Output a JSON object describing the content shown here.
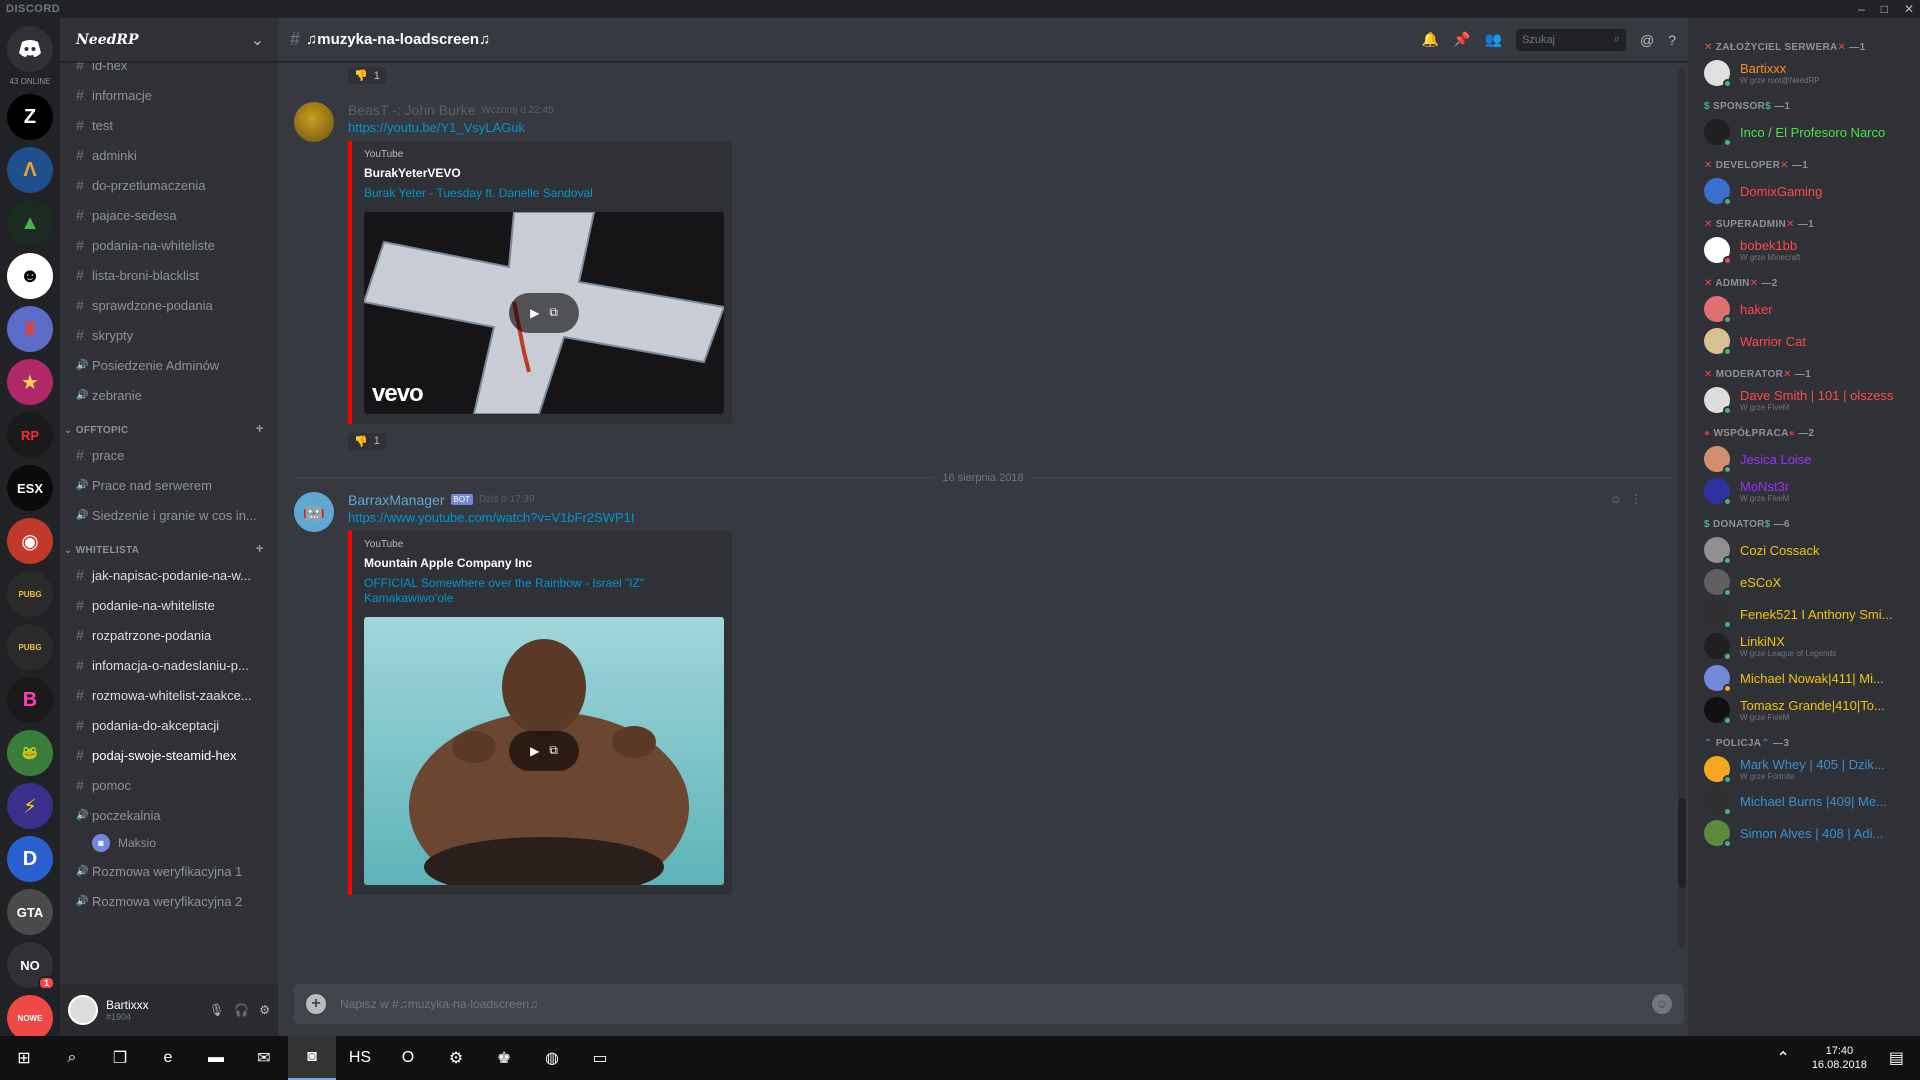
{
  "window": {
    "brand": "DISCORD",
    "controls": [
      "–",
      "□",
      "✕"
    ]
  },
  "servers": {
    "online": "43 ONLINE",
    "items": [
      {
        "label": "Z",
        "color": "#ffffff",
        "bg": "#000000"
      },
      {
        "label": "Λ",
        "color": "#f0a030",
        "bg": "#1f4f8c"
      },
      {
        "label": "▲",
        "color": "#4caf50",
        "bg": "#1b2b22"
      },
      {
        "label": "☻",
        "color": "#000000",
        "bg": "#ffffff"
      },
      {
        "label": "♜",
        "color": "#e04040",
        "bg": "#5a6bc8"
      },
      {
        "label": "★",
        "color": "#ffd24a",
        "bg": "#b0286a"
      },
      {
        "label": "RP",
        "color": "#ff2a2a",
        "bg": "#1a1a1a"
      },
      {
        "label": "ESX",
        "color": "#ffffff",
        "bg": "#0a0a0a"
      },
      {
        "label": "◉",
        "color": "#ffffff",
        "bg": "#c0392b"
      },
      {
        "label": "PUBG",
        "color": "#f0c040",
        "bg": "#2a2a2a"
      },
      {
        "label": "PUBG",
        "color": "#f0c040",
        "bg": "#2a2a2a"
      },
      {
        "label": "B",
        "color": "#ff3fae",
        "bg": "#1a1a1a"
      },
      {
        "label": "🐸",
        "color": "#ffffff",
        "bg": "#3a7d3a"
      },
      {
        "label": "⚡",
        "color": "#ffcc00",
        "bg": "#3a2f8c"
      },
      {
        "label": "D",
        "color": "#ffffff",
        "bg": "#2a5fd0"
      },
      {
        "label": "GTA",
        "color": "#ffffff",
        "bg": "#4a4a4a"
      },
      {
        "label": "NO",
        "color": "#ffffff",
        "bg": "#2f3136",
        "badge": "1"
      },
      {
        "label": "NOWE",
        "color": "#ffffff",
        "bg": "#f04747"
      }
    ]
  },
  "guild": {
    "name": "NeedRP"
  },
  "channels": [
    {
      "type": "text",
      "name": "id-hex"
    },
    {
      "type": "text",
      "name": "informacje"
    },
    {
      "type": "text",
      "name": "test"
    },
    {
      "type": "text",
      "name": "adminki"
    },
    {
      "type": "text",
      "name": "do-przetlumaczenia"
    },
    {
      "type": "text",
      "name": "pajace-sedesa"
    },
    {
      "type": "text",
      "name": "podania-na-whiteliste"
    },
    {
      "type": "text",
      "name": "lista-broni-blacklist"
    },
    {
      "type": "text",
      "name": "sprawdzone-podania"
    },
    {
      "type": "text",
      "name": "skrypty"
    },
    {
      "type": "voice",
      "name": "Posiedzenie Adminów"
    },
    {
      "type": "voice",
      "name": "zebranie"
    },
    {
      "type": "category",
      "name": "OFFTOPIC"
    },
    {
      "type": "text",
      "name": "prace"
    },
    {
      "type": "voice",
      "name": "Prace nad serwerem"
    },
    {
      "type": "voice",
      "name": "Siedzenie i granie w cos in..."
    },
    {
      "type": "category",
      "name": "WHITELISTA"
    },
    {
      "type": "text",
      "name": "jak-napisac-podanie-na-w...",
      "unread": true
    },
    {
      "type": "text",
      "name": "podanie-na-whiteliste",
      "unread": true
    },
    {
      "type": "text",
      "name": "rozpatrzone-podania",
      "unread": true
    },
    {
      "type": "text",
      "name": "infomacja-o-nadeslaniu-p...",
      "unread": true
    },
    {
      "type": "text",
      "name": "rozmowa-whitelist-zaakce...",
      "unread": true
    },
    {
      "type": "text",
      "name": "podania-do-akceptacji",
      "unread": true
    },
    {
      "type": "text",
      "name": "podaj-swoje-steamid-hex",
      "active": true
    },
    {
      "type": "text",
      "name": "pomoc"
    },
    {
      "type": "voice",
      "name": "poczekalnia"
    },
    {
      "type": "voiceuser",
      "name": "Maksio"
    },
    {
      "type": "voice",
      "name": "Rozmowa weryfikacyjna 1"
    },
    {
      "type": "voice",
      "name": "Rozmowa weryfikacyjna 2"
    }
  ],
  "user": {
    "name": "Bartixxx",
    "tag": "#1904"
  },
  "chat": {
    "channel": "♫muzyka-na-loadscreen♫",
    "search_placeholder": "Szukaj",
    "top_reaction": {
      "emoji": "👎",
      "count": "1"
    },
    "messages": [
      {
        "author": "BeasT -: John Burke",
        "author_color": "#5d6167",
        "timestamp": "Wczoraj o 22:45",
        "link": "https://youtu.be/Y1_VsyLAGuk",
        "embed": {
          "provider": "YouTube",
          "author": "BurakYeterVEVO",
          "title": "Burak Yeter - Tuesday ft. Danelle Sandoval",
          "overlay": "vevo"
        },
        "reaction": {
          "emoji": "👎",
          "count": "1"
        }
      },
      {
        "author": "BarraxManager",
        "author_color": "#5fa8d3",
        "bot": "BOT",
        "timestamp": "Dziś o 17:39",
        "link": "https://www.youtube.com/watch?v=V1bFr2SWP1I",
        "embed": {
          "provider": "YouTube",
          "author": "Mountain Apple Company Inc",
          "title": "OFFICIAL Somewhere over the Rainbow - Israel \"IZ\" Kamakawiwoʻole",
          "overlay": ""
        }
      }
    ],
    "date_divider": "16 sierpnia 2018",
    "composer_placeholder": "Napisz w #♫muzyka-na-loadscreen♫"
  },
  "members": {
    "roles": [
      {
        "name": "ZAŁOŻYCIEL SERWERA",
        "count": "—1",
        "icon": "✕",
        "icon_color": "#f04747",
        "members": [
          {
            "name": "Bartixxx",
            "color": "#ff8c1a",
            "game": "W grze root@NeedRP",
            "status": "#43b581",
            "av": "#e0e0e0"
          }
        ]
      },
      {
        "name": "SPONSOR",
        "count": "—1",
        "icon": "$",
        "icon_color": "#43b581",
        "members": [
          {
            "name": "Inco / El Profesoro Narco",
            "color": "#4ae24a",
            "game": "",
            "status": "#43b581",
            "av": "#202020"
          }
        ]
      },
      {
        "name": "DEVELOPER",
        "count": "—1",
        "icon": "✕",
        "icon_color": "#f04747",
        "members": [
          {
            "name": "DomixGaming",
            "color": "#ff4a4a",
            "game": "",
            "status": "#43b581",
            "av": "#3a6fd0"
          }
        ]
      },
      {
        "name": "SUPERADMIN",
        "count": "—1",
        "icon": "✕",
        "icon_color": "#f04747",
        "members": [
          {
            "name": "bobek1bb",
            "color": "#ff4a4a",
            "game": "W grze Minecraft",
            "status": "#f04747",
            "av": "#ffffff"
          }
        ]
      },
      {
        "name": "ADMIN",
        "count": "—2",
        "icon": "✕",
        "icon_color": "#f04747",
        "members": [
          {
            "name": "haker",
            "color": "#ff4a4a",
            "game": "",
            "status": "#43b581",
            "av": "#e07070"
          },
          {
            "name": "Warrior Cat",
            "color": "#ff4a4a",
            "game": "",
            "status": "#43b581",
            "av": "#d8c090"
          }
        ]
      },
      {
        "name": "MODERATOR",
        "count": "—1",
        "icon": "✕",
        "icon_color": "#f04747",
        "members": [
          {
            "name": "Dave Smith | 101 | olszess",
            "color": "#ff4a4a",
            "game": "W grze FiveM",
            "status": "#43b581",
            "av": "#dddddd"
          }
        ]
      },
      {
        "name": "WSPÓŁPRACA",
        "count": "—2",
        "icon": "●",
        "icon_color": "#c0392b",
        "members": [
          {
            "name": "Jesica Loise",
            "color": "#9b30ff",
            "game": "",
            "status": "#43b581",
            "av": "#d09070"
          },
          {
            "name": "MoNst3r",
            "color": "#9b30ff",
            "game": "W grze FiveM",
            "status": "#43b581",
            "av": "#3030a0"
          }
        ]
      },
      {
        "name": "DONATOR",
        "count": "—6",
        "icon": "$",
        "icon_color": "#43b581",
        "members": [
          {
            "name": "Cozi Cossack",
            "color": "#f1c40f",
            "game": "",
            "status": "#43b581",
            "av": "#909090"
          },
          {
            "name": "eSCoX",
            "color": "#f1c40f",
            "game": "",
            "status": "#43b581",
            "av": "#606060"
          },
          {
            "name": "Fenek521 I Anthony Smi...",
            "color": "#f1c40f",
            "game": "",
            "status": "#43b581",
            "av": "#303030"
          },
          {
            "name": "LinkiNX",
            "color": "#f1c40f",
            "game": "W grze League of Legends",
            "status": "#43b581",
            "av": "#202020"
          },
          {
            "name": "Michael Nowak|411| Mi...",
            "color": "#f1c40f",
            "game": "",
            "status": "#faa61a",
            "av": "#7289da"
          },
          {
            "name": "Tomasz Grande|410|To...",
            "color": "#f1c40f",
            "game": "W grze FiveM",
            "status": "#43b581",
            "av": "#101010"
          }
        ]
      },
      {
        "name": "POLICJA",
        "count": "—3",
        "icon": "⌃",
        "icon_color": "#3a8fd6",
        "members": [
          {
            "name": "Mark Whey | 405 | Dzik...",
            "color": "#3a8fd6",
            "game": "W grze Fortnite",
            "status": "#43b581",
            "av": "#f5a623"
          },
          {
            "name": "Michael Burns |409| Me...",
            "color": "#3a8fd6",
            "game": "",
            "status": "#43b581",
            "av": "#303030"
          },
          {
            "name": "Simon Alves | 408 | Adi...",
            "color": "#3a8fd6",
            "game": "",
            "status": "#43b581",
            "av": "#5a8a3a"
          }
        ]
      }
    ]
  },
  "taskbar": {
    "items": [
      {
        "label": "⊞",
        "name": "start-icon"
      },
      {
        "label": "⌕",
        "name": "search-icon"
      },
      {
        "label": "❐",
        "name": "task-view-icon"
      },
      {
        "label": "e",
        "name": "edge-icon"
      },
      {
        "label": "▬",
        "name": "file-explorer-icon"
      },
      {
        "label": "✉",
        "name": "mail-icon"
      },
      {
        "label": "◙",
        "name": "discord-taskbar-icon",
        "active": true
      },
      {
        "label": "HS",
        "name": "hearthstone-icon"
      },
      {
        "label": "O",
        "name": "opera-icon"
      },
      {
        "label": "⚙",
        "name": "app-icon-1"
      },
      {
        "label": "♚",
        "name": "app-icon-2"
      },
      {
        "label": "◍",
        "name": "app-icon-3"
      },
      {
        "label": "▭",
        "name": "app-icon-4"
      }
    ],
    "time": "17:40",
    "date": "16.08.2018"
  }
}
